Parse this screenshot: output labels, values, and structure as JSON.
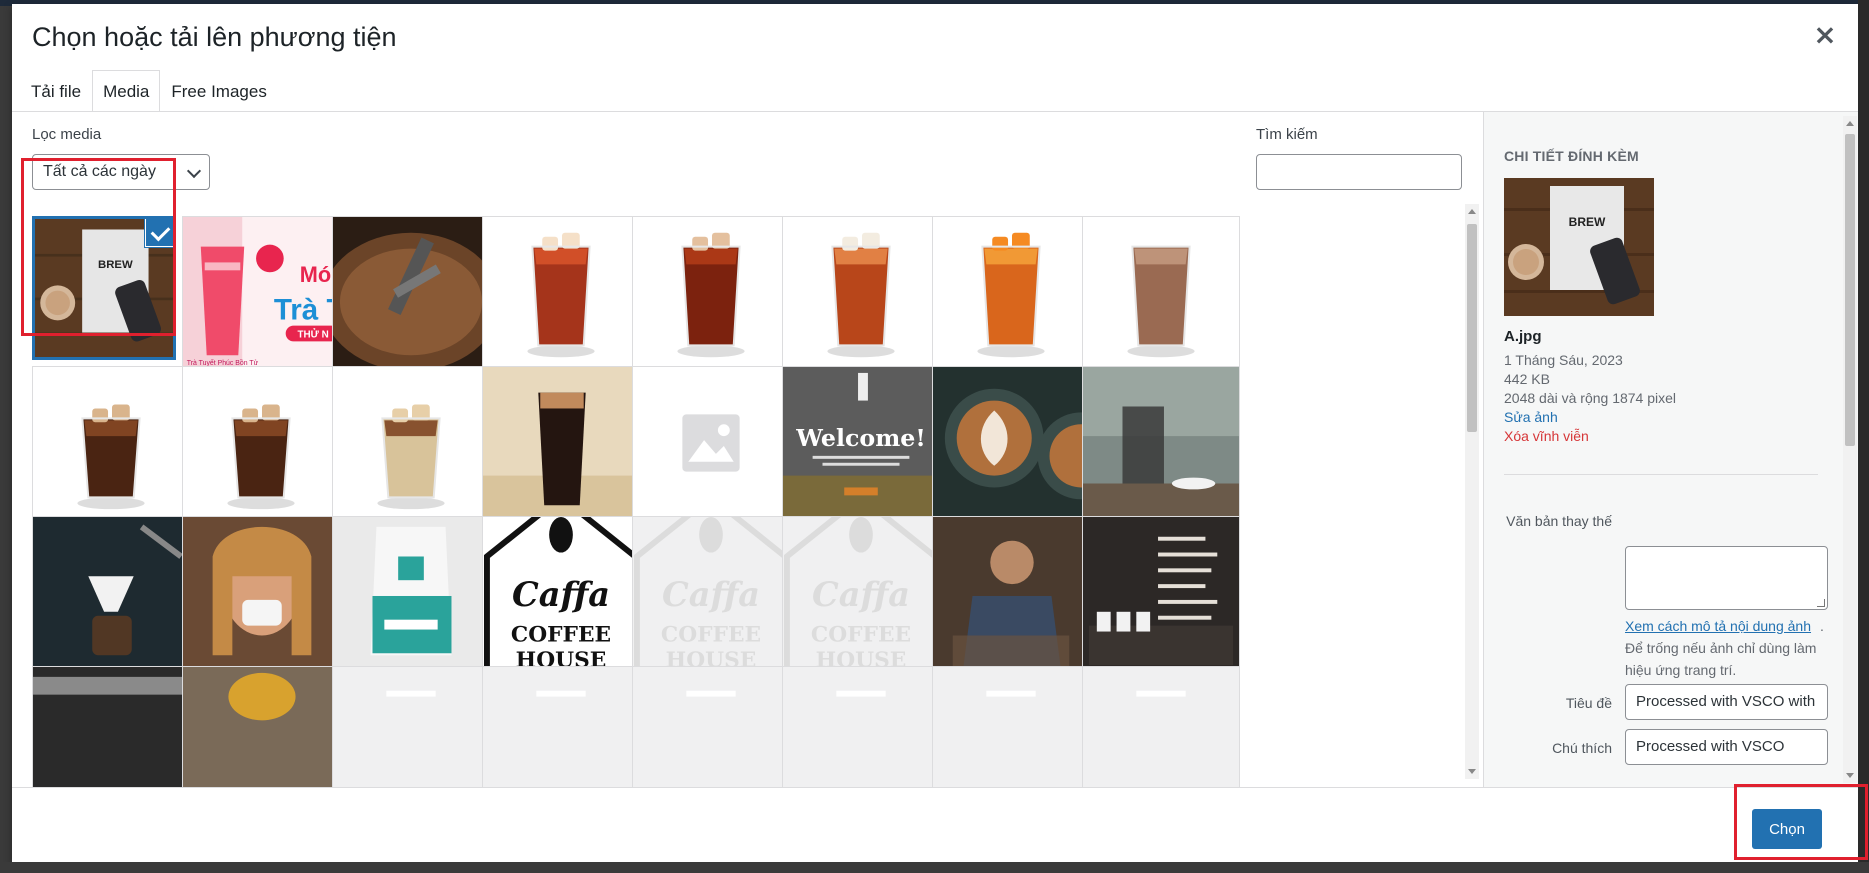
{
  "modal": {
    "title": "Chọn hoặc tải lên phương tiện",
    "close_icon": "close-icon"
  },
  "tabs": [
    {
      "label": "Tải file",
      "active": false
    },
    {
      "label": "Media",
      "active": true
    },
    {
      "label": "Free Images",
      "active": false
    }
  ],
  "filters": {
    "label": "Lọc media",
    "date_value": "Tất cả các ngày",
    "search_label": "Tìm kiếm",
    "search_value": ""
  },
  "media_items": [
    {
      "name": "brew-book-phone",
      "selected": true,
      "kind": "brew"
    },
    {
      "name": "tra-trai-cay-banner",
      "selected": false,
      "kind": "banner"
    },
    {
      "name": "coffee-roaster",
      "selected": false,
      "kind": "roaster"
    },
    {
      "name": "iced-tea-1",
      "selected": false,
      "kind": "tea-red"
    },
    {
      "name": "iced-tea-2",
      "selected": false,
      "kind": "tea-dark"
    },
    {
      "name": "iced-tea-lychee",
      "selected": false,
      "kind": "tea-lychee"
    },
    {
      "name": "iced-tea-peach",
      "selected": false,
      "kind": "tea-peach"
    },
    {
      "name": "iced-milk-coffee",
      "selected": false,
      "kind": "latte-frothy"
    },
    {
      "name": "iced-coffee-1",
      "selected": false,
      "kind": "coffee-short"
    },
    {
      "name": "iced-coffee-2",
      "selected": false,
      "kind": "coffee-short"
    },
    {
      "name": "iced-coffee-milk",
      "selected": false,
      "kind": "coffee-milk"
    },
    {
      "name": "iced-coffee-wood",
      "selected": false,
      "kind": "coffee-wood"
    },
    {
      "name": "placeholder-image",
      "selected": false,
      "kind": "placeholder"
    },
    {
      "name": "welcome-screenshot",
      "selected": false,
      "kind": "welcome"
    },
    {
      "name": "latte-art",
      "selected": false,
      "kind": "latte-art"
    },
    {
      "name": "french-press-cafe",
      "selected": false,
      "kind": "cafe"
    },
    {
      "name": "pour-over",
      "selected": false,
      "kind": "pourover"
    },
    {
      "name": "woman-drinking",
      "selected": false,
      "kind": "woman"
    },
    {
      "name": "coffee-bag",
      "selected": false,
      "kind": "bag"
    },
    {
      "name": "caffa-logo-black",
      "selected": false,
      "kind": "logo-dark"
    },
    {
      "name": "caffa-logo-light-1",
      "selected": false,
      "kind": "logo-light"
    },
    {
      "name": "caffa-logo-light-2",
      "selected": false,
      "kind": "logo-light"
    },
    {
      "name": "barista",
      "selected": false,
      "kind": "barista"
    },
    {
      "name": "menu-board",
      "selected": false,
      "kind": "menu"
    },
    {
      "name": "espresso-machine",
      "selected": false,
      "kind": "dark-partial"
    },
    {
      "name": "person-hat",
      "selected": false,
      "kind": "hat-partial"
    },
    {
      "name": "loading-1",
      "selected": false,
      "kind": "blank"
    },
    {
      "name": "loading-2",
      "selected": false,
      "kind": "blank"
    },
    {
      "name": "loading-3",
      "selected": false,
      "kind": "blank"
    },
    {
      "name": "loading-4",
      "selected": false,
      "kind": "blank"
    },
    {
      "name": "loading-5",
      "selected": false,
      "kind": "blank"
    },
    {
      "name": "loading-6",
      "selected": false,
      "kind": "blank"
    }
  ],
  "logo_text": {
    "word": "Caffa",
    "line1": "COFFEE",
    "line2": "HOUSE"
  },
  "thumb_text": {
    "brew": "BREW",
    "banner_big": "Trà T",
    "banner_side": "Mó",
    "banner_tag": "THỬ N",
    "banner_small": "Trà Tuyết Phúc Bồn Tử",
    "welcome": "Welcome!"
  },
  "details": {
    "heading": "CHI TIẾT ĐÍNH KÈM",
    "filename": "A.jpg",
    "date": "1 Tháng Sáu, 2023",
    "filesize": "442 KB",
    "dimensions": "2048 dài và rộng 1874 pixel",
    "edit_link": "Sửa ảnh",
    "delete_link": "Xóa vĩnh viễn",
    "alt_label": "Văn bản thay thế",
    "alt_value": "",
    "alt_help_link": "Xem cách mô tả nội dung ảnh",
    "alt_help_punct": ".",
    "alt_help_text": "Để trống nếu ảnh chỉ dùng làm hiệu ứng trang trí.",
    "title_label": "Tiêu đề",
    "title_value": "Processed with VSCO with",
    "caption_label": "Chú thích",
    "caption_value": "Processed with VSCO"
  },
  "toolbar": {
    "select_label": "Chọn"
  },
  "colors": {
    "accent": "#2271b1",
    "danger": "#d63638",
    "highlight": "#e0202e"
  }
}
